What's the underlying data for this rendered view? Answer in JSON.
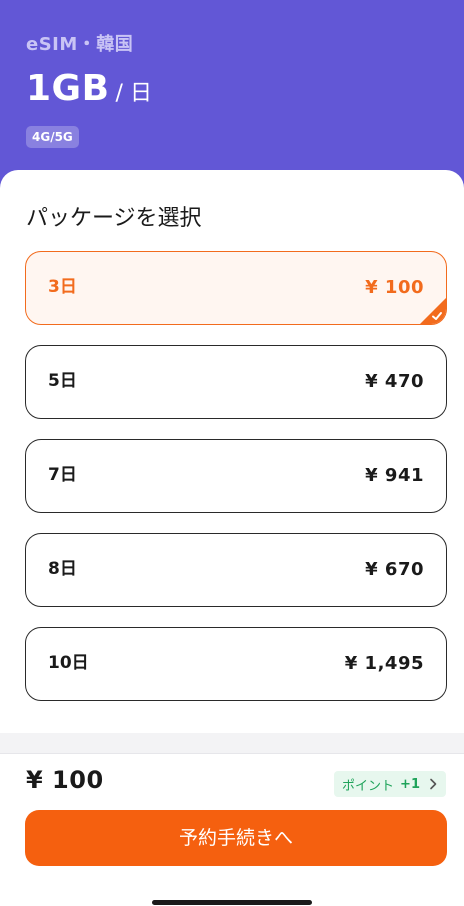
{
  "header": {
    "subtitle": "eSIM・韓国",
    "data_amount": "1GB",
    "per_unit": "/ 日",
    "network": "4G/5G",
    "background_color": "#6257d6"
  },
  "packages": {
    "title": "パッケージを選択",
    "selected_index": 0,
    "items": [
      {
        "days": "3日",
        "price": "¥ 100"
      },
      {
        "days": "5日",
        "price": "¥ 470"
      },
      {
        "days": "7日",
        "price": "¥ 941"
      },
      {
        "days": "8日",
        "price": "¥ 670"
      },
      {
        "days": "10日",
        "price": "¥ 1,495"
      }
    ]
  },
  "footer": {
    "total": "¥ 100",
    "points_label": "ポイント",
    "points_value": "+1",
    "cta_label": "予約手続きへ"
  },
  "colors": {
    "accent": "#f26b1d",
    "cta": "#f5600f",
    "points_green": "#1fa35a"
  },
  "icons": [
    "check-icon",
    "chevron-right-icon"
  ]
}
